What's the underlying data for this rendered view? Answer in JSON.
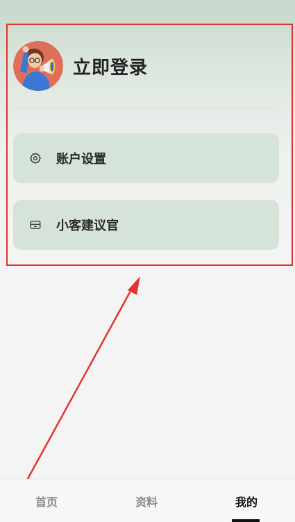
{
  "profile": {
    "login_label": "立即登录",
    "avatar_icon": "user-megaphone-avatar"
  },
  "menu": {
    "items": [
      {
        "label": "账户设置",
        "icon": "gear-icon"
      },
      {
        "label": "小客建议官",
        "icon": "inbox-icon"
      }
    ]
  },
  "tabbar": {
    "tabs": [
      {
        "label": "首页",
        "active": false
      },
      {
        "label": "资料",
        "active": false
      },
      {
        "label": "我的",
        "active": true
      }
    ]
  },
  "colors": {
    "card_bg": "#d5e3d8",
    "highlight": "#e2332f",
    "active_tab": "#111111",
    "inactive_tab": "#8a8a8a"
  }
}
